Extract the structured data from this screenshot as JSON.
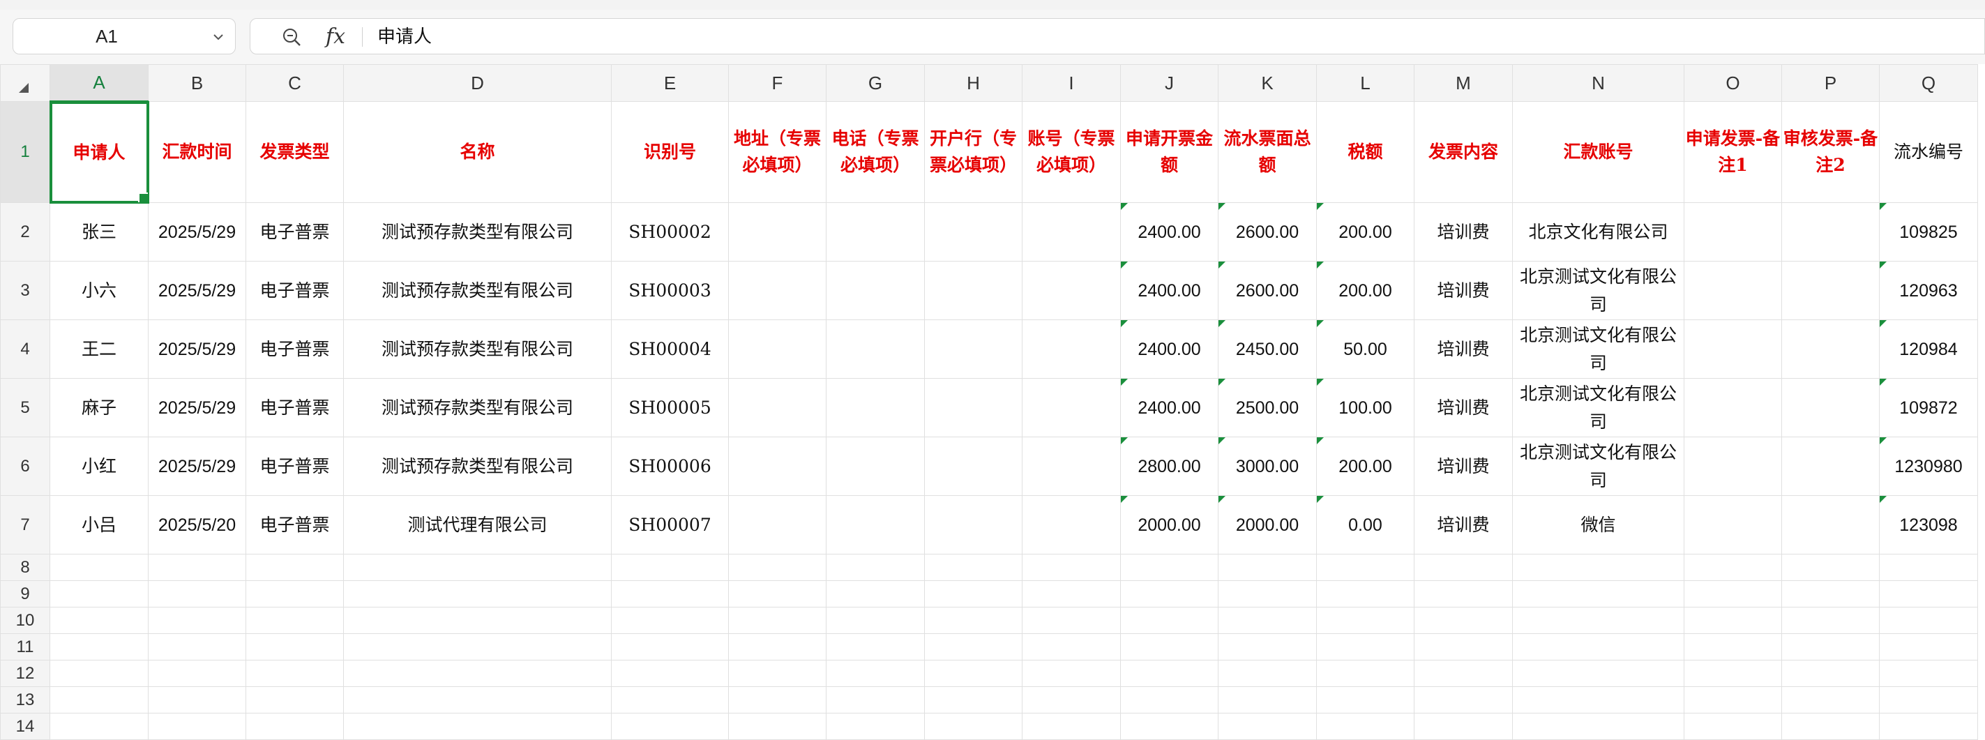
{
  "namebox": {
    "ref": "A1"
  },
  "formula_bar": {
    "fx_label": "fx",
    "content": "申请人"
  },
  "columns": [
    "A",
    "B",
    "C",
    "D",
    "E",
    "F",
    "G",
    "H",
    "I",
    "J",
    "K",
    "L",
    "M",
    "N",
    "O",
    "P",
    "Q"
  ],
  "header_row": {
    "row_num": "1",
    "cells": [
      "申请人",
      "汇款时间",
      "发票类型",
      "名称",
      "识别号",
      "地址（专票必填项）",
      "电话（专票必填项）",
      "开户行（专票必填项）",
      "账号（专票必填项）",
      "申请开票金额",
      "流水票面总额",
      "税额",
      "发票内容",
      "汇款账号",
      "申请发票-备注1",
      "审核发票-备注2",
      "流水编号"
    ]
  },
  "rows": [
    {
      "num": "2",
      "cells": [
        "张三",
        "2025/5/29",
        "电子普票",
        "测试预存款类型有限公司",
        "SH00002",
        "",
        "",
        "",
        "",
        "2400.00",
        "2600.00",
        "200.00",
        "培训费",
        "北京文化有限公司",
        "",
        "",
        "109825"
      ]
    },
    {
      "num": "3",
      "cells": [
        "小六",
        "2025/5/29",
        "电子普票",
        "测试预存款类型有限公司",
        "SH00003",
        "",
        "",
        "",
        "",
        "2400.00",
        "2600.00",
        "200.00",
        "培训费",
        "北京测试文化有限公司",
        "",
        "",
        "120963"
      ]
    },
    {
      "num": "4",
      "cells": [
        "王二",
        "2025/5/29",
        "电子普票",
        "测试预存款类型有限公司",
        "SH00004",
        "",
        "",
        "",
        "",
        "2400.00",
        "2450.00",
        "50.00",
        "培训费",
        "北京测试文化有限公司",
        "",
        "",
        "120984"
      ]
    },
    {
      "num": "5",
      "cells": [
        "麻子",
        "2025/5/29",
        "电子普票",
        "测试预存款类型有限公司",
        "SH00005",
        "",
        "",
        "",
        "",
        "2400.00",
        "2500.00",
        "100.00",
        "培训费",
        "北京测试文化有限公司",
        "",
        "",
        "109872"
      ]
    },
    {
      "num": "6",
      "cells": [
        "小红",
        "2025/5/29",
        "电子普票",
        "测试预存款类型有限公司",
        "SH00006",
        "",
        "",
        "",
        "",
        "2800.00",
        "3000.00",
        "200.00",
        "培训费",
        "北京测试文化有限公司",
        "",
        "",
        "1230980"
      ]
    },
    {
      "num": "7",
      "cells": [
        "小吕",
        "2025/5/20",
        "电子普票",
        "测试代理有限公司",
        "SH00007",
        "",
        "",
        "",
        "",
        "2000.00",
        "2000.00",
        "0.00",
        "培训费",
        "微信",
        "",
        "",
        "123098"
      ]
    }
  ],
  "empty_rows": [
    "8",
    "9",
    "10",
    "11",
    "12",
    "13",
    "14"
  ],
  "colors": {
    "accent": "#1a8f3c",
    "header_text": "#e60000"
  }
}
